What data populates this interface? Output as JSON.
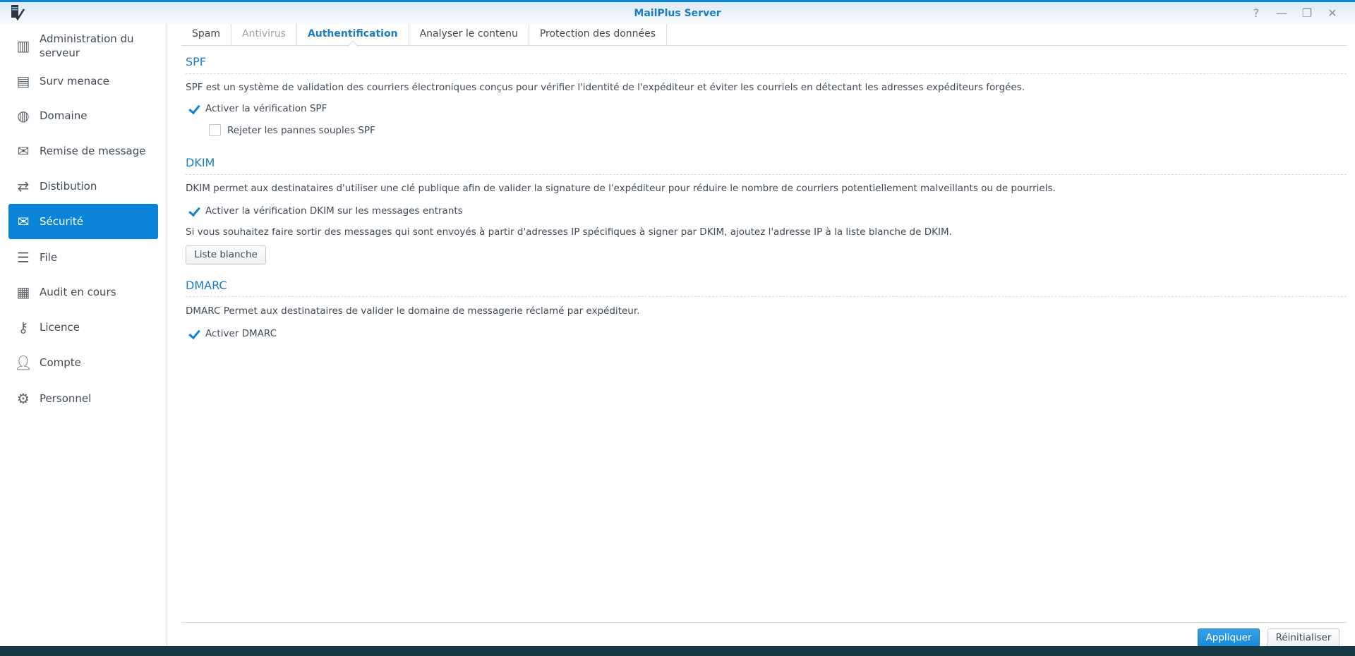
{
  "window": {
    "title": "MailPlus Server",
    "controls": [
      "?",
      "—",
      "❐",
      "✕"
    ]
  },
  "sidebar": {
    "items": [
      {
        "label": "Administration du serveur",
        "line1": "Administration du",
        "line2": "serveur",
        "icon": "server-admin-icon"
      },
      {
        "label": "Surv menace",
        "icon": "id-card-icon"
      },
      {
        "label": "Domaine",
        "icon": "globe-icon"
      },
      {
        "label": "Remise de message",
        "icon": "mail-upload-icon"
      },
      {
        "label": "Distibution",
        "icon": "arrows-exchange-icon"
      },
      {
        "label": "Sécurité",
        "icon": "mail-shield-icon",
        "selected": true
      },
      {
        "label": "File",
        "icon": "list-icon"
      },
      {
        "label": "Audit en cours",
        "icon": "document-list-icon"
      },
      {
        "label": "Licence",
        "icon": "key-icon"
      },
      {
        "label": "Compte",
        "icon": "user-icon"
      },
      {
        "label": "Personnel",
        "icon": "gear-icon"
      }
    ]
  },
  "tabs": [
    {
      "label": "Spam"
    },
    {
      "label": "Antivirus",
      "disabled": true
    },
    {
      "label": "Authentification",
      "active": true
    },
    {
      "label": "Analyser le contenu"
    },
    {
      "label": "Protection des données"
    }
  ],
  "spf": {
    "heading": "SPF",
    "description": "SPF est un système de validation des courriers électroniques conçus pour vérifier l'identité de l'expéditeur et éviter les courriels en détectant les adresses expéditeurs forgées.",
    "enable_label": "Activer la vérification SPF",
    "enable_checked": true,
    "reject_label": "Rejeter les pannes souples SPF",
    "reject_checked": false
  },
  "dkim": {
    "heading": "DKIM",
    "description": "DKIM permet aux destinataires d'utiliser une clé publique afin de valider la signature de l'expéditeur pour réduire le nombre de courriers potentiellement malveillants ou de pourriels.",
    "enable_label": "Activer la vérification DKIM sur les messages entrants",
    "enable_checked": true,
    "whitelist_note": "Si vous souhaitez faire sortir des messages qui sont envoyés à partir d'adresses IP spécifiques à signer par DKIM, ajoutez l'adresse IP à la liste blanche de DKIM.",
    "whitelist_button": "Liste blanche"
  },
  "dmarc": {
    "heading": "DMARC",
    "description": "DMARC Permet aux destinataires de valider le domaine de messagerie réclamé par expéditeur.",
    "enable_label": "Activer DMARC",
    "enable_checked": true
  },
  "footer": {
    "apply": "Appliquer",
    "reset": "Réinitialiser"
  },
  "colors": {
    "accent": "#0a84d6",
    "heading": "#1b7dc4",
    "bottombar": "#173b45"
  }
}
